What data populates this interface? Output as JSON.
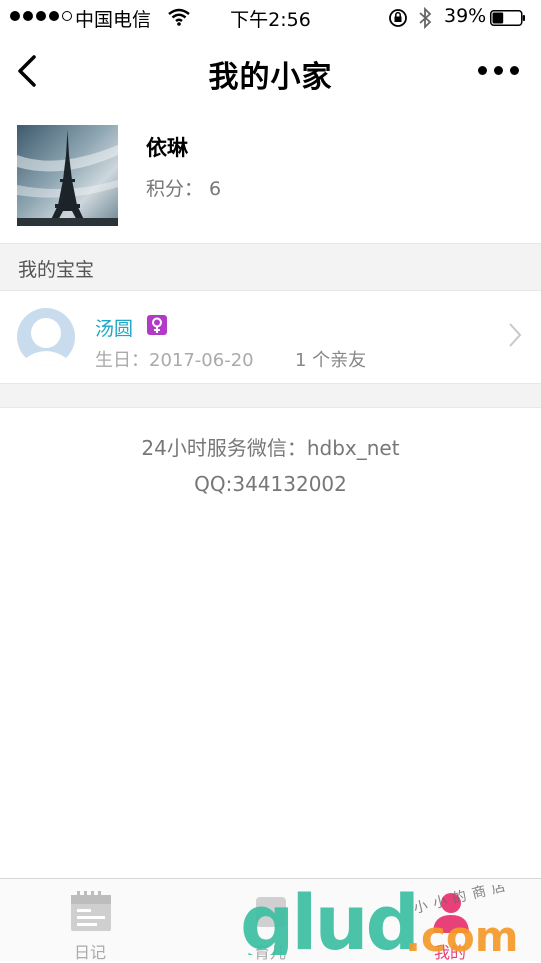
{
  "status_bar": {
    "carrier": "中国电信",
    "time": "下午2:56",
    "battery": "39%",
    "battery_level": 0.39
  },
  "nav": {
    "title": "我的小家"
  },
  "profile": {
    "name": "依琳",
    "points": "积分：  6"
  },
  "section": {
    "title": "我的宝宝"
  },
  "baby": {
    "name": "汤圆",
    "gender_symbol": "♀",
    "birthday": "生日：2017-06-20",
    "friends": "1 个亲友"
  },
  "service": {
    "wechat": "24小时服务微信：hdbx_net",
    "qq": "QQ:344132002"
  },
  "tabs": [
    {
      "label": "日记",
      "icon": "calendar-icon"
    },
    {
      "label": "育儿",
      "icon": "parenting-icon"
    },
    {
      "label": "我的",
      "icon": "profile-icon"
    }
  ],
  "watermark": {
    "brand": "glud",
    "suffix": ".com",
    "tagline": "小小的商店"
  },
  "colors": {
    "accent_teal": "#1ea7c4",
    "tab_active": "#e8417a",
    "gender_badge": "#b13bc7"
  }
}
